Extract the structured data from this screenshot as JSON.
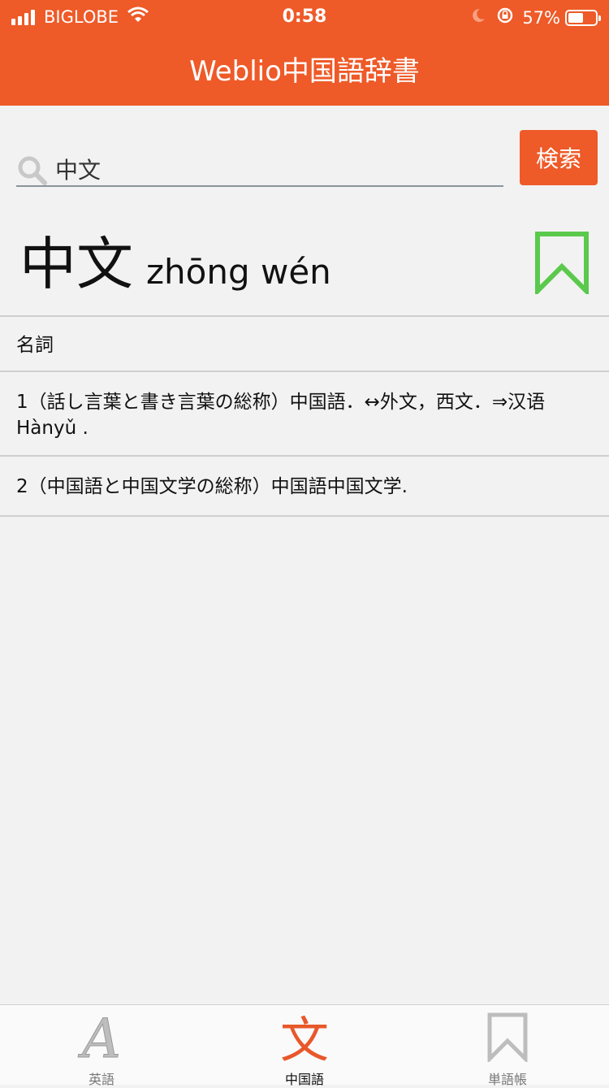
{
  "status": {
    "carrier": "BIGLOBE",
    "time": "0:58",
    "battery": "57%",
    "battery_level": 0.57
  },
  "header": {
    "title": "Weblio中国語辞書"
  },
  "search": {
    "query": "中文",
    "button_label": "検索",
    "icon": "search-icon"
  },
  "entry": {
    "headword": "中文",
    "pinyin": "zhōng wén",
    "bookmark_icon": "bookmark-icon",
    "bookmark_color": "#5ac94c"
  },
  "rows": {
    "pos": "名詞",
    "sense1_line1": "1（話し言葉と書き言葉の総称）中国語．↔外文，西文．⇒汉语",
    "sense1_line2": "Hànyǔ .",
    "sense2": "2（中国語と中国文学の総称）中国語中国文学."
  },
  "tabs": [
    {
      "label": "英語",
      "icon": "letter-a-icon"
    },
    {
      "label": "中国語",
      "icon": "chinese-character-icon",
      "active": true
    },
    {
      "label": "単語帳",
      "icon": "bookmark-icon"
    }
  ],
  "colors": {
    "accent": "#ee5a28",
    "background": "#f2f2f2"
  }
}
